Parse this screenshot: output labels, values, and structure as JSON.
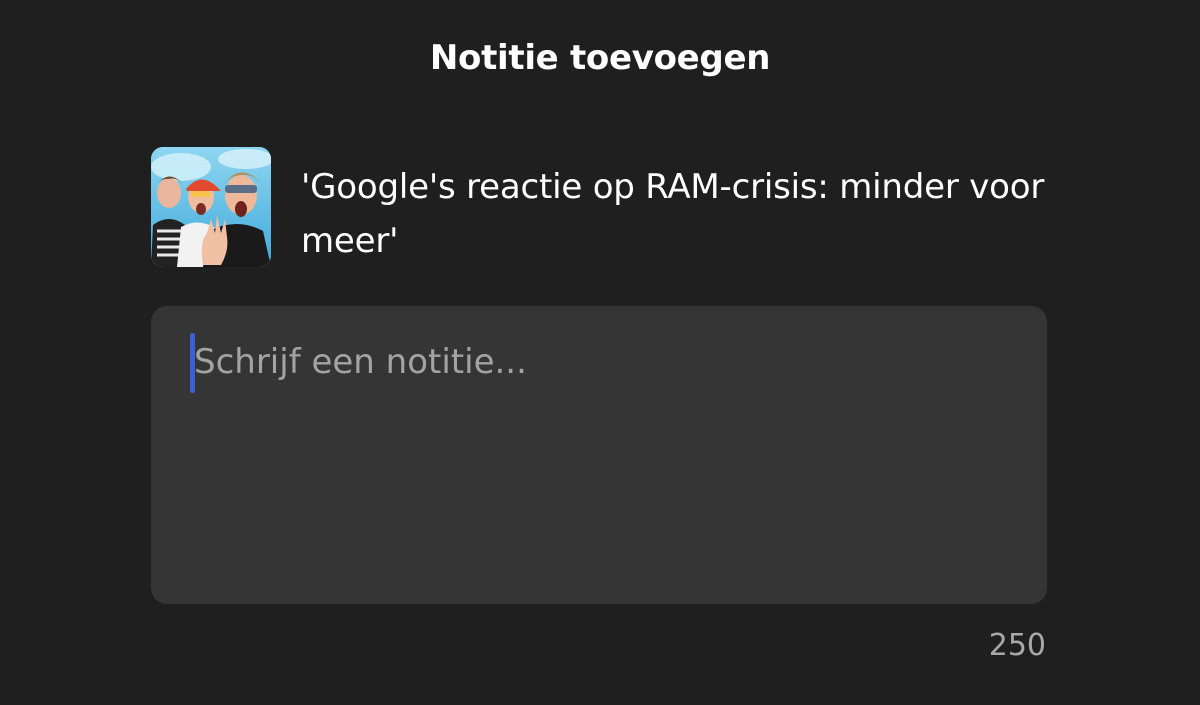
{
  "dialog": {
    "title": "Notitie toevoegen"
  },
  "episode": {
    "thumbnail_icon": "podcast-cover-image",
    "title": "'Google's reactie op RAM-crisis: minder voor meer'"
  },
  "note": {
    "value": "",
    "placeholder": "Schrijf een notitie...",
    "remaining_characters": "250"
  },
  "colors": {
    "background": "#1f1f1f",
    "input_background": "#353535",
    "caret": "#3d5fd6",
    "placeholder": "#a3a3a3",
    "counter": "#a8a8a8"
  }
}
